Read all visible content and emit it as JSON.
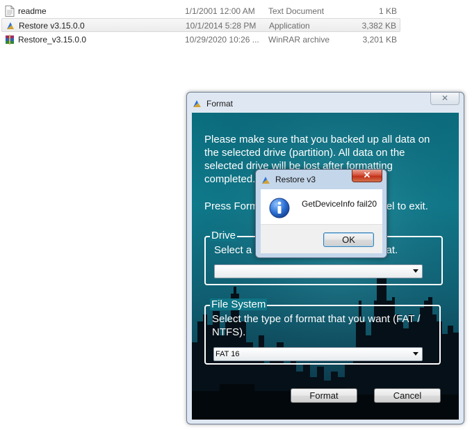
{
  "files": [
    {
      "name": "readme",
      "date": "1/1/2001 12:00 AM",
      "type": "Text Document",
      "size": "1 KB",
      "icon": "text-file-icon"
    },
    {
      "name": "Restore v3.15.0.0",
      "date": "10/1/2014 5:28 PM",
      "type": "Application",
      "size": "3,382 KB",
      "icon": "application-icon"
    },
    {
      "name": "Restore_v3.15.0.0",
      "date": "10/29/2020 10:26 ...",
      "type": "WinRAR archive",
      "size": "3,201 KB",
      "icon": "winrar-archive-icon"
    }
  ],
  "format_window": {
    "title": "Format",
    "close_label": "✕",
    "message_line1": "Please make sure that you backed up all data on",
    "message_line2": "the selected drive (partition).  All data on the",
    "message_line3": "selected drive will be lost after formatting",
    "message_line4": "completed.",
    "press_prefix": "Press Form",
    "press_suffix": "ncel to exit.",
    "drive_group": {
      "legend": "Drive",
      "prompt_prefix": "Select a",
      "prompt_suffix": "mat.",
      "selected": ""
    },
    "fs_group": {
      "legend": "File System",
      "prompt_line1": "Select the type of format that you want (FAT /",
      "prompt_line2": "NTFS).",
      "selected": "FAT 16"
    },
    "format_button": "Format",
    "cancel_button": "Cancel"
  },
  "message_box": {
    "title": "Restore v3",
    "close_label": "✕",
    "text": "GetDeviceInfo fail20",
    "ok_button": "OK",
    "icon": "information-icon"
  },
  "colors": {
    "close_red": "#c1301a",
    "client_teal": "#0e7c8d"
  }
}
